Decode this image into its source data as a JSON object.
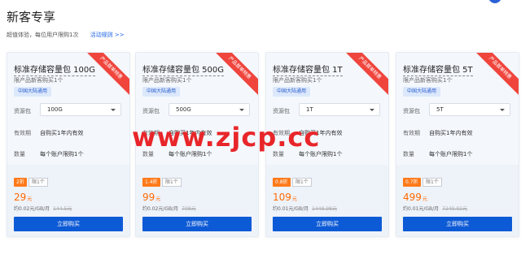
{
  "page": {
    "title": "新客专享",
    "subtitle": "超值体验，每位用户限购1次",
    "rules_link": "活动规则 >>"
  },
  "labels": {
    "resource_pack": "资源包",
    "validity": "有效期",
    "quantity": "数量",
    "ribbon": "产品首单特惠",
    "region": "中国大陆通用",
    "buy": "立即购买",
    "limit_badge": "限1个",
    "price_unit": "元",
    "validity_value": "自购买1年内有效",
    "quantity_value": "每个账户限购1个"
  },
  "cards": [
    {
      "name": "标准存储容量包 100G",
      "limit": "限产品新客购买1个",
      "size": "100G",
      "discount": "2折",
      "price": "29",
      "per_unit": "约0.02元/GB/月",
      "original": "144.5元"
    },
    {
      "name": "标准存储容量包 500G",
      "limit": "限产品新客购买1个",
      "size": "500G",
      "discount": "1.4折",
      "price": "99",
      "per_unit": "约0.02元/GB/月",
      "original": "708元"
    },
    {
      "name": "标准存储容量包 1T",
      "limit": "限产品新客购买1个",
      "size": "1T",
      "discount": "0.8折",
      "price": "109",
      "per_unit": "约0.01元/GB/月",
      "original": "1449.98元"
    },
    {
      "name": "标准存储容量包 5T",
      "limit": "限产品新客购买1个",
      "size": "5T",
      "discount": "0.7折",
      "price": "499",
      "per_unit": "约0.01元/GB/月",
      "original": "7249.92元"
    }
  ],
  "watermark": "www.zjcp.cc",
  "colors": {
    "accent": "#0d5ad6",
    "price": "#ff6a00",
    "ribbon": "#f0453d",
    "discount": "#ff7a1a"
  }
}
